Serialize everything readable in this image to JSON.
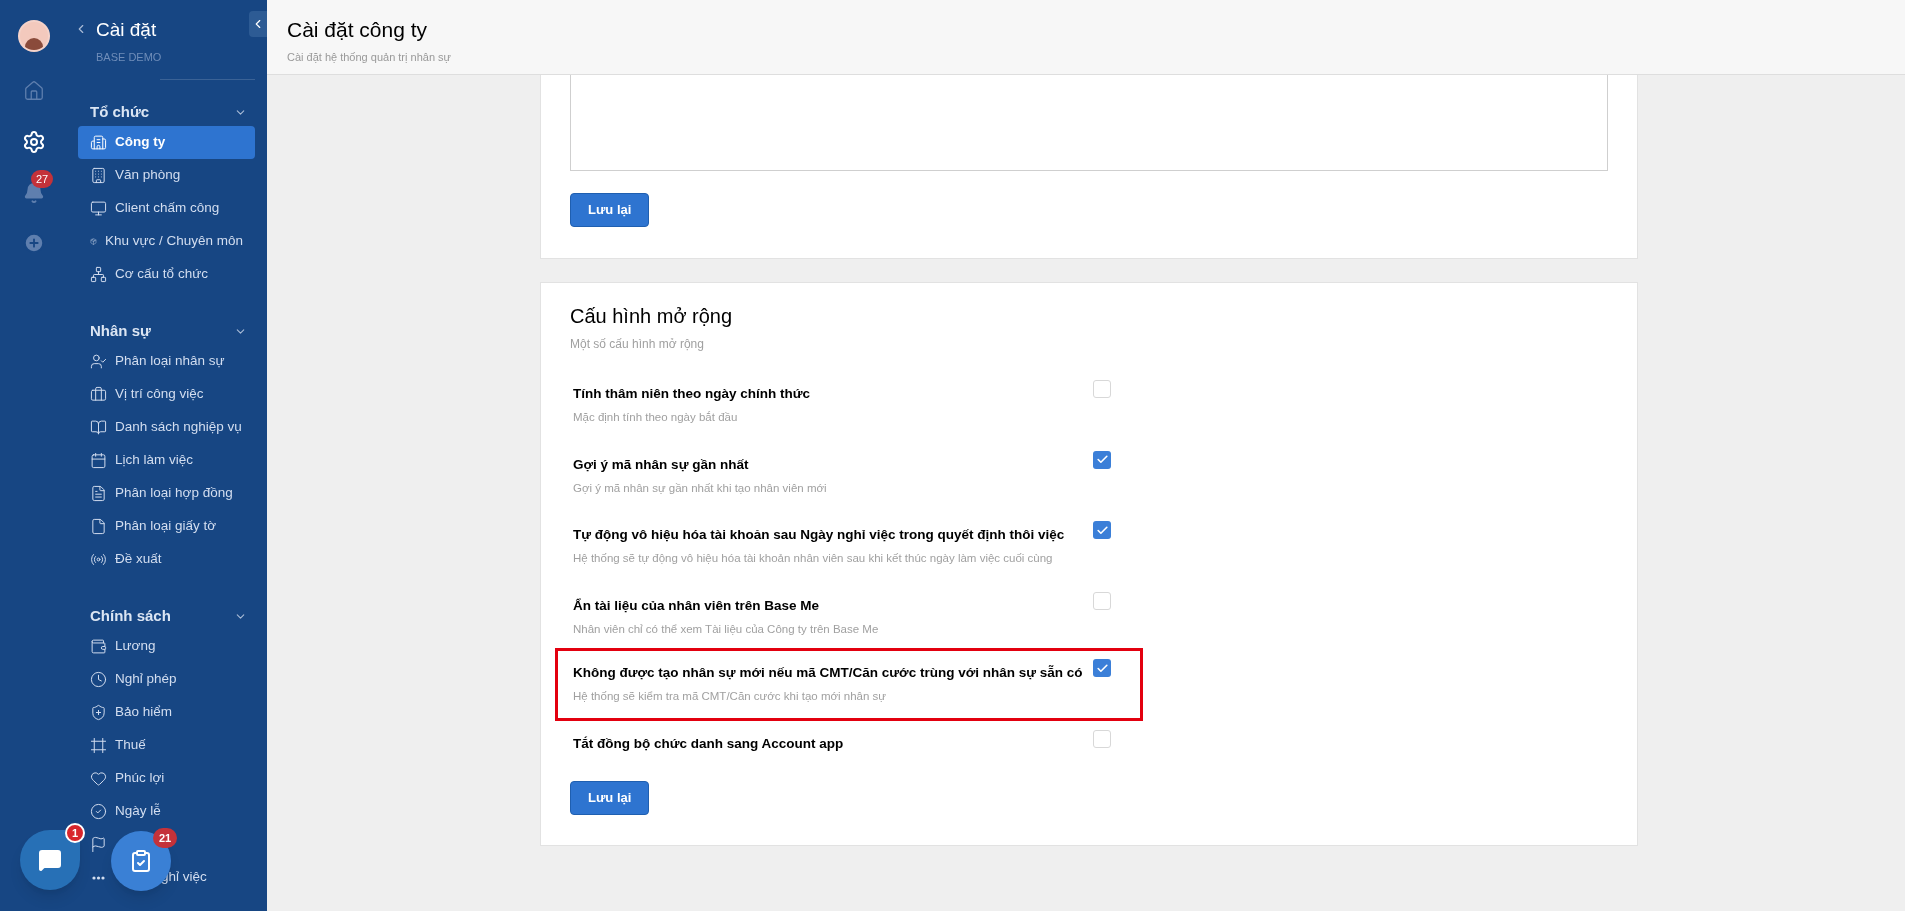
{
  "rail": {
    "notification_count": "27"
  },
  "sidebar": {
    "title": "Cài đặt",
    "subtitle": "BASE DEMO",
    "sections": [
      {
        "title": "Tổ chức",
        "expanded": true,
        "items": [
          {
            "label": "Công ty",
            "selected": true
          },
          {
            "label": "Văn phòng",
            "selected": false
          },
          {
            "label": "Client chấm công",
            "selected": false
          },
          {
            "label": "Khu vực / Chuyên môn",
            "selected": false
          },
          {
            "label": "Cơ cấu tổ chức",
            "selected": false
          }
        ]
      },
      {
        "title": "Nhân sự",
        "expanded": true,
        "items": [
          {
            "label": "Phân loại nhân sự",
            "selected": false
          },
          {
            "label": "Vị trí công việc",
            "selected": false
          },
          {
            "label": "Danh sách nghiệp vụ",
            "selected": false
          },
          {
            "label": "Lịch làm việc",
            "selected": false
          },
          {
            "label": "Phân loại hợp đồng",
            "selected": false
          },
          {
            "label": "Phân loại giấy tờ",
            "selected": false
          },
          {
            "label": "Đề xuất",
            "selected": false
          }
        ]
      },
      {
        "title": "Chính sách",
        "expanded": true,
        "items": [
          {
            "label": "Lương",
            "selected": false
          },
          {
            "label": "Nghỉ phép",
            "selected": false
          },
          {
            "label": "Bảo hiểm",
            "selected": false
          },
          {
            "label": "Thuế",
            "selected": false
          },
          {
            "label": "Phúc lợi",
            "selected": false
          },
          {
            "label": "Ngày lễ",
            "selected": false
          },
          {
            "selected": false
          },
          {
            "label": "ghỉ việc",
            "selected": false
          }
        ]
      }
    ]
  },
  "header": {
    "title": "Cài đặt công ty",
    "subtitle": "Cài đặt hệ thống quản trị nhân sự"
  },
  "top_card": {
    "save_button": "Lưu lại"
  },
  "extended_card": {
    "title": "Cấu hình mở rộng",
    "subtitle": "Một số cấu hình mở rộng",
    "options": [
      {
        "title": "Tính thâm niên theo ngày chính thức",
        "description": "Mặc định tính theo ngày bắt đầu",
        "checked": false,
        "highlighted": false
      },
      {
        "title": "Gợi ý mã nhân sự gần nhất",
        "description": "Gợi ý mã nhân sự gần nhất khi tạo nhân viên mới",
        "checked": true,
        "highlighted": false
      },
      {
        "title": "Tự động vô hiệu hóa tài khoản sau Ngày nghỉ việc trong quyết định thôi việc",
        "description": "Hệ thống sẽ tự động vô hiệu hóa tài khoản nhân viên sau khi kết thúc ngày làm việc cuối cùng",
        "checked": true,
        "highlighted": false
      },
      {
        "title": "Ẩn tài liệu của nhân viên trên Base Me",
        "description": "Nhân viên chỉ có thể xem Tài liệu của Công ty trên Base Me",
        "checked": false,
        "highlighted": false
      },
      {
        "title": "Không được tạo nhân sự mới nếu mã CMT/Căn cước trùng với nhân sự sẵn có",
        "description": "Hệ thống sẽ kiểm tra mã CMT/Căn cước khi tạo mới nhân sự",
        "checked": true,
        "highlighted": true
      },
      {
        "title": "Tắt đồng bộ chức danh sang Account app",
        "checked": false,
        "highlighted": false
      }
    ],
    "save_button": "Lưu lại"
  },
  "floating": {
    "chat_count": "1",
    "tasks_count": "21"
  }
}
